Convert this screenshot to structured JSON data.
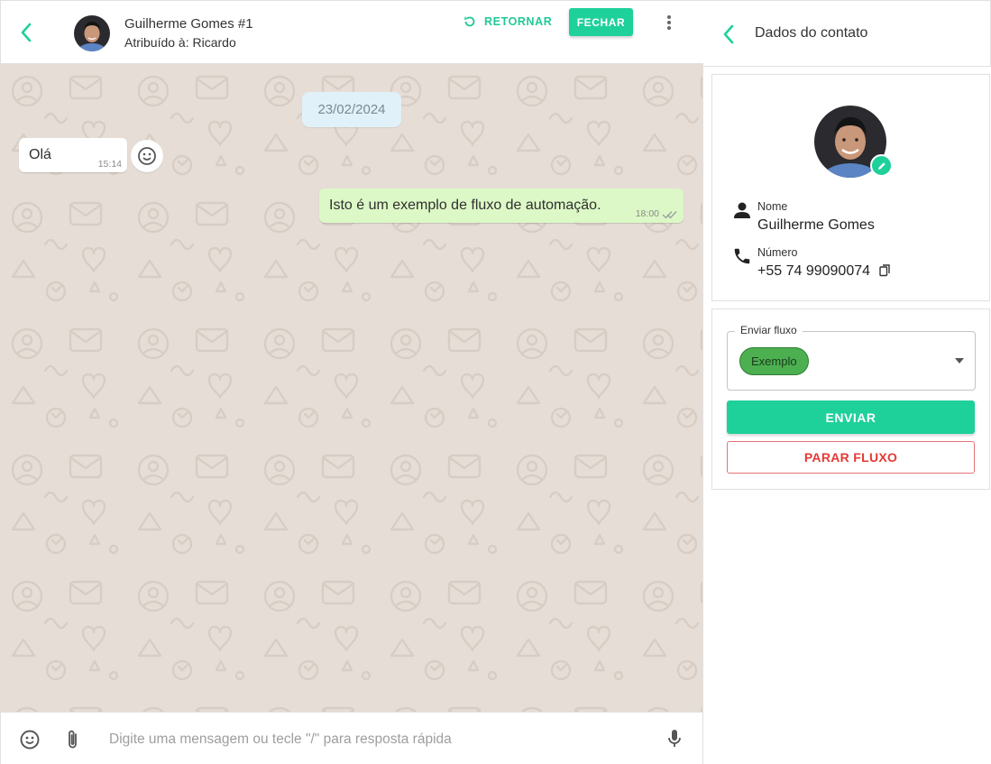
{
  "colors": {
    "accent": "#1ed09a",
    "chat_background": "#e6ded6",
    "outgoing_bubble": "#dcf8c6",
    "date_chip": "#e1f1f9",
    "danger": "#e53935",
    "tag_green": "#4caf50"
  },
  "chat_header": {
    "back_icon": "chevron-left-icon",
    "contact_name": "Guilherme Gomes #1",
    "assigned_to": "Atribuído à: Ricardo",
    "return_label": "RETORNAR",
    "return_icon": "refresh-icon",
    "close_label": "FECHAR",
    "more_icon": "more-vertical-icon"
  },
  "messages": {
    "date": "23/02/2024",
    "incoming": [
      {
        "text": "Olá",
        "time": "15:14"
      }
    ],
    "outgoing": [
      {
        "text": "Isto é um exemplo de fluxo de automação.",
        "time": "18:00",
        "status_icon": "double-check-icon"
      }
    ],
    "reaction_icon": "smiley-icon"
  },
  "composer": {
    "emoji_icon": "smiley-icon",
    "attach_icon": "paperclip-icon",
    "placeholder": "Digite uma mensagem ou tecle \"/\" para resposta rápida",
    "value": "",
    "mic_icon": "microphone-icon"
  },
  "contact_panel": {
    "title": "Dados do contato",
    "back_icon": "chevron-left-icon",
    "edit_icon": "pencil-icon",
    "name_label": "Nome",
    "name_value": "Guilherme Gomes",
    "name_icon": "person-icon",
    "phone_label": "Número",
    "phone_value": "+55 74 99090074",
    "phone_icon": "phone-icon",
    "copy_icon": "copy-icon"
  },
  "flow": {
    "legend": "Enviar fluxo",
    "selected_flow": "Exemplo",
    "caret_icon": "caret-down-icon",
    "send_label": "ENVIAR",
    "stop_label": "PARAR FLUXO"
  }
}
